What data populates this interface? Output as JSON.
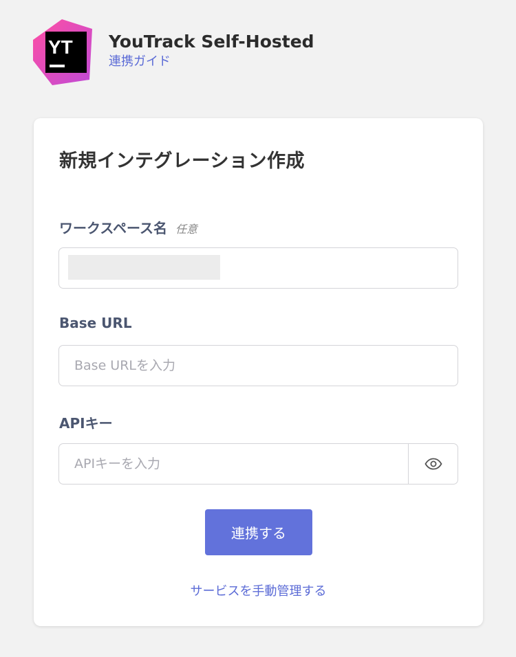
{
  "header": {
    "logo_text": "YT",
    "title": "YouTrack Self-Hosted",
    "guide_link": "連携ガイド"
  },
  "card": {
    "title": "新規インテグレーション作成",
    "workspace": {
      "label": "ワークスペース名",
      "optional": "任意",
      "value": ""
    },
    "base_url": {
      "label": "Base URL",
      "placeholder": "Base URLを入力"
    },
    "api_key": {
      "label": "APIキー",
      "placeholder": "APIキーを入力"
    },
    "submit_label": "連携する",
    "manual_link": "サービスを手動管理する"
  },
  "colors": {
    "accent": "#6272db",
    "link": "#5b6bd6",
    "label": "#4b5670",
    "logo_pink": "#ec4fa8",
    "logo_magenta": "#d649cc"
  },
  "icons": {
    "logo": "youtrack-logo-icon",
    "password_toggle": "eye-icon"
  }
}
